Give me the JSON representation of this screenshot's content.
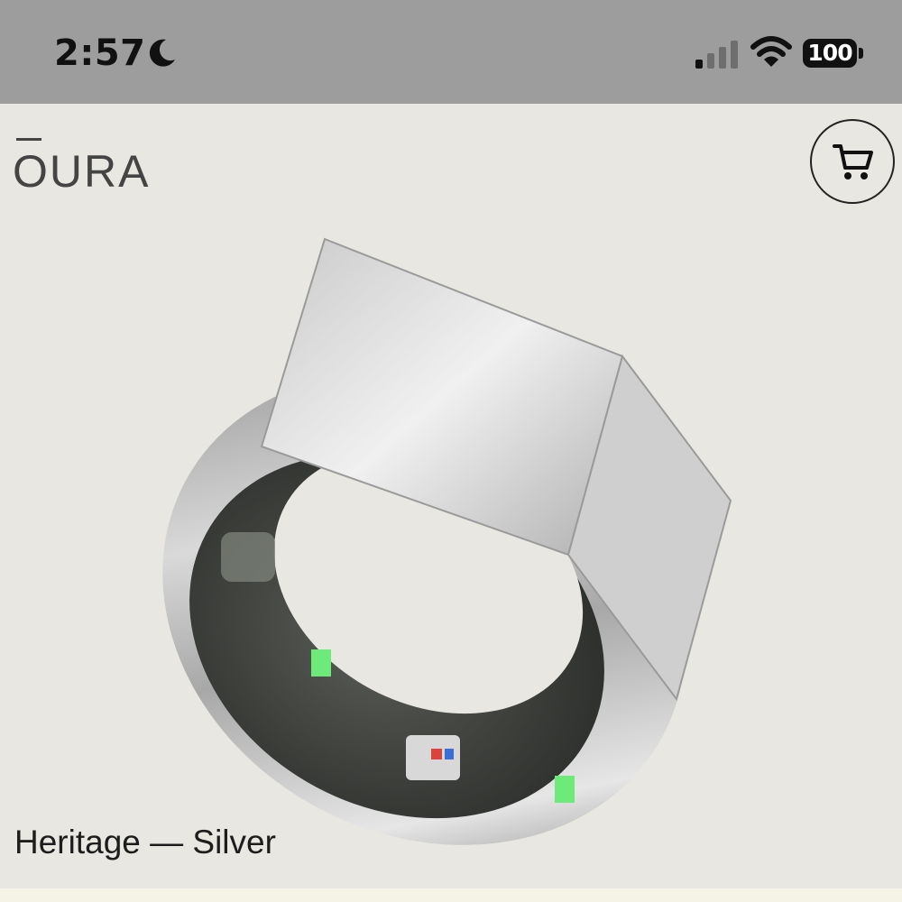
{
  "status_bar": {
    "time": "2:57",
    "battery_level": "100",
    "icons": [
      "moon-icon",
      "cellular-signal-icon",
      "wifi-icon",
      "battery-icon"
    ],
    "signal_bars_active": 1,
    "signal_bars_total": 4
  },
  "header": {
    "logo": "OURA",
    "cart_icon": "cart-icon"
  },
  "product": {
    "name": "Heritage — Silver",
    "image_icon": "ring-product-image"
  },
  "colors": {
    "status_bar_bg": "#9d9d9d",
    "page_bg": "#e8e7e1",
    "text": "#1d1d1d"
  }
}
